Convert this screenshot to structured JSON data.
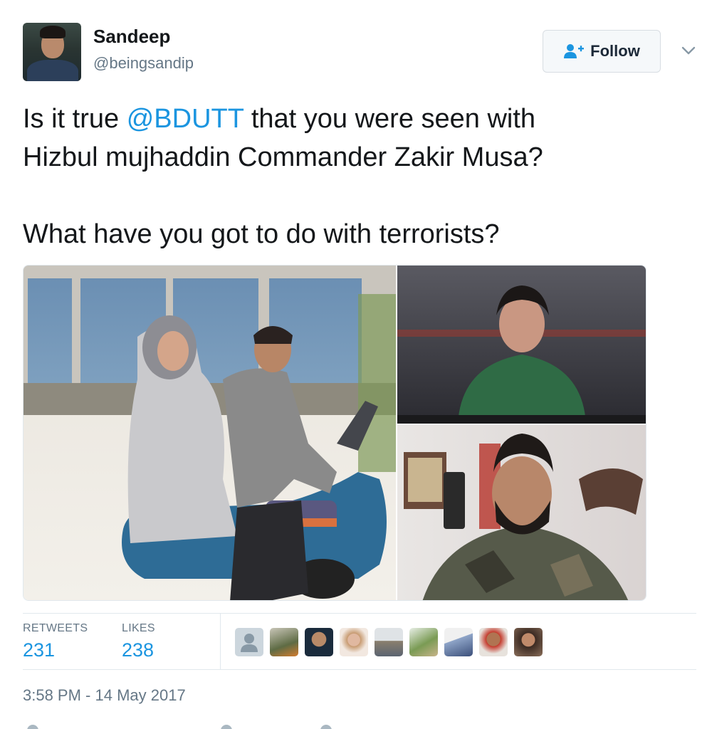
{
  "author": {
    "name": "Sandeep",
    "handle": "@beingsandip"
  },
  "follow_button": {
    "label": "Follow",
    "icon": "add-user-icon"
  },
  "tweet": {
    "line1_pre": "Is it true ",
    "mention": "@BDUTT",
    "line1_post": " that you were seen with",
    "line2": "Hizbul mujhaddin Commander Zakir Musa?",
    "line3": "What have you got to do with terrorists?"
  },
  "stats": {
    "retweets_label": "RETWEETS",
    "retweets_count": "231",
    "likes_label": "LIKES",
    "likes_count": "238"
  },
  "timestamp": "3:58 PM - 14 May 2017",
  "colors": {
    "link": "#1b95e0",
    "muted": "#657786",
    "text": "#14171a"
  }
}
